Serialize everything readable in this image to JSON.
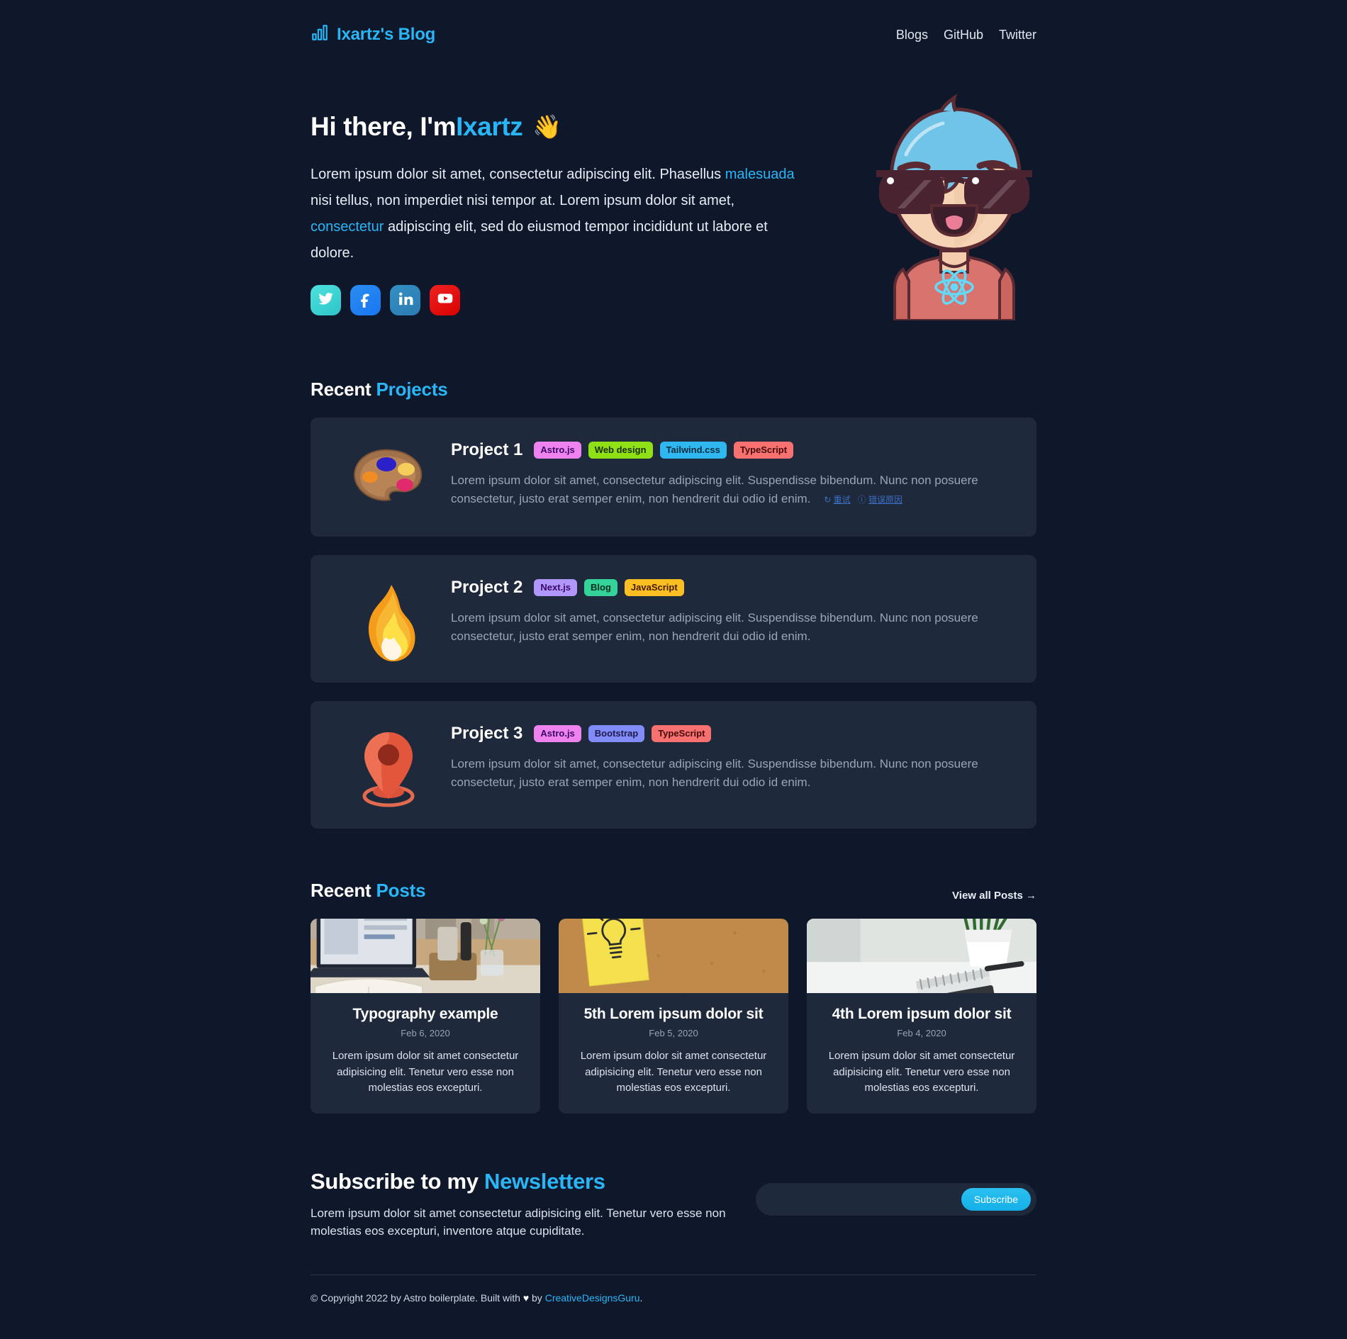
{
  "nav": {
    "brand": "Ixartz's Blog",
    "brand_icon": "bar-chart-icon",
    "links": [
      {
        "label": "Blogs"
      },
      {
        "label": "GitHub"
      },
      {
        "label": "Twitter"
      }
    ]
  },
  "hero": {
    "greeting": "Hi there, I'm ",
    "name": "Ixartz",
    "wave": "👋",
    "paragraph_parts": [
      "Lorem ipsum dolor sit amet, consectetur adipiscing elit. Phasellus ",
      "malesuada",
      " nisi tellus, non imperdiet nisi tempor at. Lorem ipsum dolor sit amet, ",
      "consectetur",
      " adipiscing elit, sed do eiusmod tempor incididunt ut labore et dolore."
    ],
    "socials": [
      {
        "name": "twitter-icon",
        "label": "Twitter"
      },
      {
        "name": "facebook-icon",
        "label": "Facebook"
      },
      {
        "name": "linkedin-icon",
        "label": "LinkedIn"
      },
      {
        "name": "youtube-icon",
        "label": "YouTube"
      }
    ],
    "avatar_alt": "Cartoon avatar with blue hair, sunglasses and a React t-shirt"
  },
  "projects_section": {
    "title_plain": "Recent ",
    "title_accent": "Projects",
    "items": [
      {
        "icon": "artist-palette-emoji",
        "name": "Project 1",
        "tags": [
          {
            "label": "Astro.js",
            "bg": "#ee82ee",
            "fg": "#3b0764"
          },
          {
            "label": "Web design",
            "bg": "#8fe014",
            "fg": "#1a2e05"
          },
          {
            "label": "Tailwind.css",
            "bg": "#2fb8ef",
            "fg": "#0c2b3e"
          },
          {
            "label": "TypeScript",
            "bg": "#f87171",
            "fg": "#450a0a"
          }
        ],
        "description": "Lorem ipsum dolor sit amet, consectetur adipiscing elit. Suspendisse bibendum. Nunc non posuere consectetur, justo erat semper enim, non hendrerit dui odio id enim.",
        "broken_image": {
          "retry": "重试",
          "reason": "错误原因"
        }
      },
      {
        "icon": "fire-emoji",
        "name": "Project 2",
        "tags": [
          {
            "label": "Next.js",
            "bg": "#b197fc",
            "fg": "#3b0764"
          },
          {
            "label": "Blog",
            "bg": "#34d399",
            "fg": "#052e1a"
          },
          {
            "label": "JavaScript",
            "bg": "#fbbf24",
            "fg": "#451a03"
          }
        ],
        "description": "Lorem ipsum dolor sit amet, consectetur adipiscing elit. Suspendisse bibendum. Nunc non posuere consectetur, justo erat semper enim, non hendrerit dui odio id enim."
      },
      {
        "icon": "round-pushpin-emoji",
        "name": "Project 3",
        "tags": [
          {
            "label": "Astro.js",
            "bg": "#ee82ee",
            "fg": "#3b0764"
          },
          {
            "label": "Bootstrap",
            "bg": "#818cf8",
            "fg": "#1e1b4b"
          },
          {
            "label": "TypeScript",
            "bg": "#f87171",
            "fg": "#450a0a"
          }
        ],
        "description": "Lorem ipsum dolor sit amet, consectetur adipiscing elit. Suspendisse bibendum. Nunc non posuere consectetur, justo erat semper enim, non hendrerit dui odio id enim."
      }
    ]
  },
  "posts_section": {
    "title_plain": "Recent ",
    "title_accent": "Posts",
    "view_all": "View all Posts →",
    "items": [
      {
        "image": "laptop-notebook-desk-photo",
        "title": "Typography example",
        "date": "Feb 6, 2020",
        "description": "Lorem ipsum dolor sit amet consectetur adipisicing elit. Tenetur vero esse non molestias eos excepturi."
      },
      {
        "image": "lightbulb-sticky-note-corkboard-photo",
        "title": "5th Lorem ipsum dolor sit",
        "date": "Feb 5, 2020",
        "description": "Lorem ipsum dolor sit amet consectetur adipisicing elit. Tenetur vero esse non molestias eos excepturi."
      },
      {
        "image": "plant-notebook-pen-desk-photo",
        "title": "4th Lorem ipsum dolor sit",
        "date": "Feb 4, 2020",
        "description": "Lorem ipsum dolor sit amet consectetur adipisicing elit. Tenetur vero esse non molestias eos excepturi."
      }
    ]
  },
  "newsletter": {
    "title_plain": "Subscribe to my ",
    "title_accent": "Newsletters",
    "text": "Lorem ipsum dolor sit amet consectetur adipisicing elit. Tenetur vero esse non molestias eos excepturi, inventore atque cupiditate.",
    "input_value": "",
    "input_placeholder": "",
    "button_label": "Subscribe"
  },
  "footer": {
    "copyright_before": "© Copyright 2022 by Astro boilerplate. Built with ",
    "heart": "♥",
    "copyright_mid": " by ",
    "link": "CreativeDesignsGuru",
    "copyright_after": "."
  },
  "colors": {
    "background": "#0f172a",
    "card": "#1e293b",
    "accent": "#29b6f6",
    "text": "#e2e8f0",
    "muted": "#97a6bb"
  }
}
